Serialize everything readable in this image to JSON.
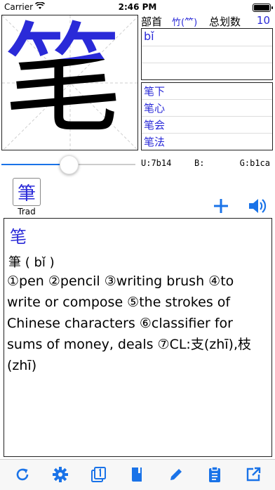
{
  "status_bar": {
    "carrier": "Carrier",
    "time": "2:46 PM",
    "battery_level": 1.0
  },
  "character": {
    "glyph": "笔",
    "radical_color": "#2a2ad8",
    "body_color": "#000000"
  },
  "info": {
    "radical_label": "部首",
    "radical_value": "竹(⺮)",
    "strokes_label": "总划数",
    "strokes_value": "10"
  },
  "pinyin": "bǐ",
  "words": [
    "笔下",
    "笔心",
    "笔会",
    "笔法"
  ],
  "slider": {
    "value": 0.5
  },
  "codes": {
    "unicode": "U:7b14",
    "big5": "B:",
    "gb": "G:b1ca"
  },
  "trad": {
    "glyph": "筆",
    "label": "Trad"
  },
  "definition": {
    "headword": "笔",
    "pinyin_line": "筆 ( bǐ )",
    "text": "①pen ②pencil ③writing brush ④to write or compose ⑤the strokes of Chinese characters ⑥classifier for sums of money, deals ⑦CL:支(zhī),枝(zhī)"
  },
  "colors": {
    "accent": "#1a73e8",
    "link_blue": "#2a2ad8"
  },
  "toolbar": {
    "icons": [
      "refresh-icon",
      "gear-icon",
      "copy-icon",
      "book-icon",
      "pencil-icon",
      "clipboard-icon",
      "share-icon"
    ]
  }
}
